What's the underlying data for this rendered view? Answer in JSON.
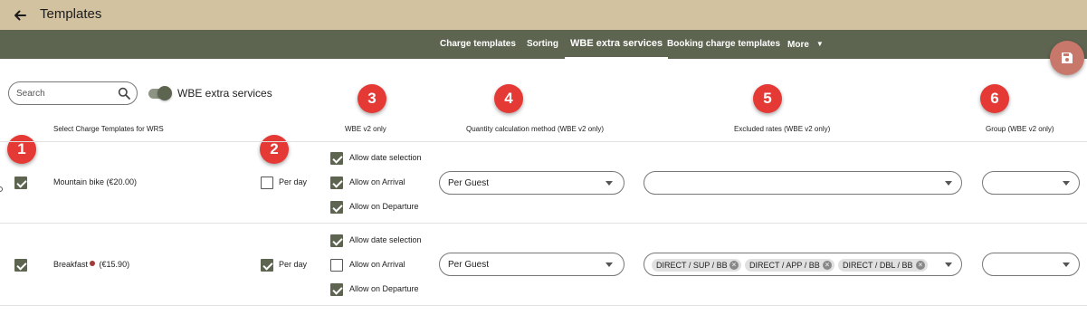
{
  "header": {
    "title": "Templates",
    "back_icon": "arrow-left-icon"
  },
  "tabs": [
    {
      "label": "Charge templates",
      "active": false
    },
    {
      "label": "Sorting",
      "active": false
    },
    {
      "label": "WBE extra services",
      "active": true
    },
    {
      "label": "Booking charge templates",
      "active": false
    },
    {
      "label": "More",
      "active": false
    }
  ],
  "save_button": {
    "icon": "floppy-disk-icon"
  },
  "search": {
    "placeholder": "Search",
    "value": ""
  },
  "toggle": {
    "label": "WBE extra services",
    "on": true
  },
  "markers": [
    "1",
    "2",
    "3",
    "4",
    "5",
    "6"
  ],
  "columns": {
    "select_templates": "Select Charge Templates for WRS",
    "wbe_v2_only": "WBE v2 only",
    "quantity_method": "Quantity calculation method (WBE v2 only)",
    "excluded_rates": "Excluded rates (WBE v2 only)",
    "group": "Group (WBE v2 only)"
  },
  "rows": [
    {
      "selected": true,
      "name": "Mountain bike (€20.00)",
      "per_day_checked": false,
      "per_day_label": "Per day",
      "options": [
        {
          "label": "Allow date selection",
          "checked": true
        },
        {
          "label": "Allow on Arrival",
          "checked": true
        },
        {
          "label": "Allow on Departure",
          "checked": true
        }
      ],
      "quantity_method": "Per Guest",
      "excluded_rates": [],
      "group": ""
    },
    {
      "selected": true,
      "name_prefix": "Breakfast",
      "name_suffix": "(€15.90)",
      "name_icon": "rose-icon",
      "per_day_checked": true,
      "per_day_label": "Per day",
      "options": [
        {
          "label": "Allow date selection",
          "checked": true
        },
        {
          "label": "Allow on Arrival",
          "checked": false
        },
        {
          "label": "Allow on Departure",
          "checked": true
        }
      ],
      "quantity_method": "Per Guest",
      "excluded_rates": [
        "DIRECT / SUP / BB",
        "DIRECT / APP / BB",
        "DIRECT / DBL / BB"
      ],
      "group": ""
    }
  ],
  "colors": {
    "topbar": "#d2c29f",
    "tabbar": "#5d6450",
    "accent": "#5d6450",
    "marker": "#e53935",
    "fab": "#c8786a"
  }
}
